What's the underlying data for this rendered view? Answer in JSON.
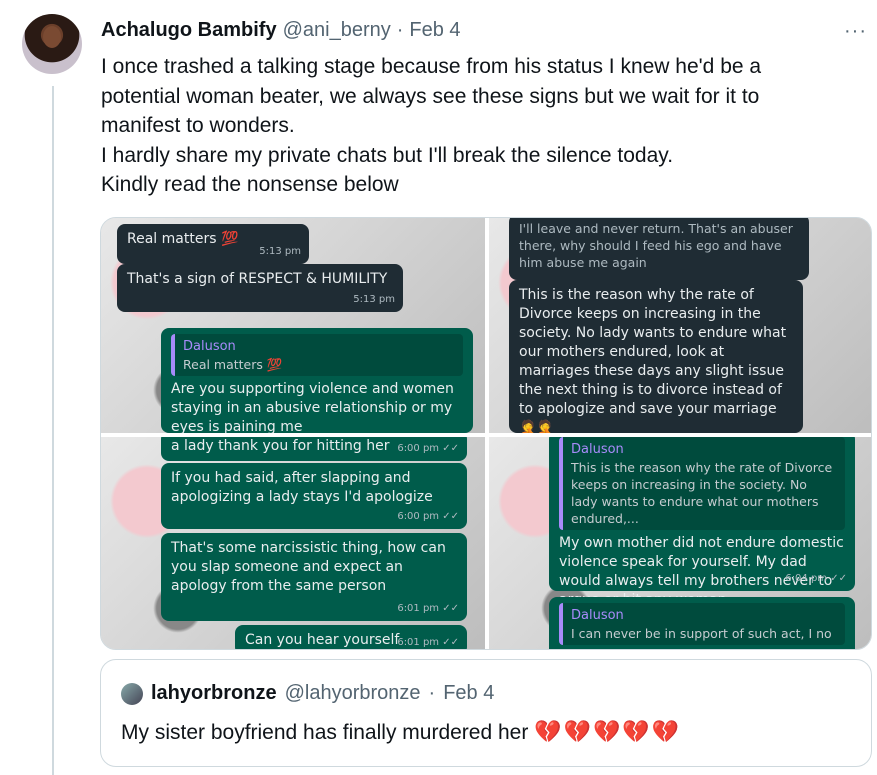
{
  "tweet": {
    "display_name": "Achalugo Bambify",
    "handle": "@ani_berny",
    "dot": "·",
    "date": "Feb 4",
    "more_icon": "···",
    "lines": [
      "I once trashed a talking stage because from his status I knew he'd be a",
      "potential woman beater,  we always see these signs but we wait for it to",
      "manifest to wonders.",
      "I hardly share my private chats but I'll break the silence today.",
      "Kindly read the nonsense below"
    ]
  },
  "media": {
    "tile1": {
      "b1": {
        "text": "Real matters 💯",
        "time": "5:13 pm"
      },
      "b2": {
        "text": "That's a sign of RESPECT & HUMILITY",
        "time": "5:13 pm"
      },
      "b3": {
        "quote_name": "Daluson",
        "quote_text": "Real matters 💯",
        "text": "Are you supporting violence and women staying in an abusive relationship or my eyes is paining me"
      }
    },
    "tile2": {
      "b1": {
        "text": "I'll leave and never return. That's an abuser there, why should I feed his ego and have him abuse me again"
      },
      "b2": {
        "text": "This is the reason why the rate of Divorce keeps on increasing in the society. No lady wants to endure what our mothers endured, look at marriages these days any slight issue the next thing is to divorce instead of to apologize and save your marriage 🤦🤦"
      }
    },
    "tile3": {
      "b1": {
        "text": "a lady thank you for hitting her",
        "time": "6:00 pm ✓✓"
      },
      "b2": {
        "text": "If you had said, after slapping and apologizing a lady stays I'd apologize",
        "time": "6:00 pm ✓✓"
      },
      "b3": {
        "text": "That's some narcissistic thing,  how can you slap someone and expect an apology from the same person",
        "time": "6:01 pm ✓✓"
      },
      "b4": {
        "text": "Can you hear yourself",
        "time": "6:01 pm ✓✓"
      }
    },
    "tile4": {
      "b1": {
        "quote_name": "Daluson",
        "quote_text": "This is the reason why the rate of Divorce keeps on increasing in the society. No lady wants to endure what our mothers endured,...",
        "text": "My own mother did not endure domestic violence speak for yourself.  My dad would always tell my brothers never to argue or hit any woman.",
        "time": "6:04 pm ✓✓"
      },
      "b2": {
        "quote_name": "Daluson",
        "quote_text": "I can never be in support of such act, I no"
      }
    }
  },
  "quoted_tweet": {
    "display_name": "lahyorbronze",
    "handle": "@lahyorbronze",
    "dot": "·",
    "date": "Feb 4",
    "text": "My sister boyfriend has finally murdered her",
    "emoji": "💔💔💔💔💔"
  }
}
